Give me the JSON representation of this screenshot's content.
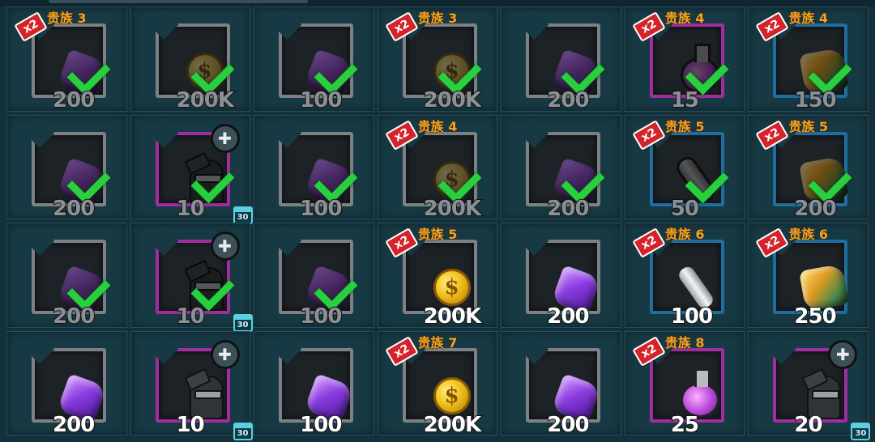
{
  "cells": [
    {
      "x2": "x2",
      "tier": "贵族 3",
      "item": "gem",
      "amount": "200",
      "claimed": true,
      "frame": "grey"
    },
    {
      "x2": "",
      "tier": "",
      "item": "coin",
      "amount": "200K",
      "claimed": true,
      "frame": "grey"
    },
    {
      "x2": "",
      "tier": "",
      "item": "gem",
      "amount": "100",
      "claimed": true,
      "frame": "grey"
    },
    {
      "x2": "x2",
      "tier": "贵族 3",
      "item": "coin",
      "amount": "200K",
      "claimed": true,
      "frame": "grey"
    },
    {
      "x2": "",
      "tier": "",
      "item": "gem",
      "amount": "200",
      "claimed": true,
      "frame": "grey"
    },
    {
      "x2": "x2",
      "tier": "贵族 4",
      "item": "flask",
      "amount": "15",
      "claimed": true,
      "frame": "purple"
    },
    {
      "x2": "x2",
      "tier": "贵族 4",
      "item": "stone",
      "amount": "150",
      "claimed": true,
      "frame": "blue"
    },
    {
      "x2": "",
      "tier": "",
      "item": "gem",
      "amount": "200",
      "claimed": true,
      "frame": "grey"
    },
    {
      "x2": "",
      "tier": "",
      "item": "hero",
      "amount": "10",
      "claimed": true,
      "frame": "purple",
      "puzzle": true,
      "calendar": "30"
    },
    {
      "x2": "",
      "tier": "",
      "item": "gem",
      "amount": "100",
      "claimed": true,
      "frame": "grey"
    },
    {
      "x2": "x2",
      "tier": "贵族 4",
      "item": "coin",
      "amount": "200K",
      "claimed": true,
      "frame": "grey"
    },
    {
      "x2": "",
      "tier": "",
      "item": "gem",
      "amount": "200",
      "claimed": true,
      "frame": "grey"
    },
    {
      "x2": "x2",
      "tier": "贵族 5",
      "item": "tube",
      "amount": "50",
      "claimed": true,
      "frame": "blue"
    },
    {
      "x2": "x2",
      "tier": "贵族 5",
      "item": "stone",
      "amount": "200",
      "claimed": true,
      "frame": "blue"
    },
    {
      "x2": "",
      "tier": "",
      "item": "gem",
      "amount": "200",
      "claimed": true,
      "frame": "grey"
    },
    {
      "x2": "",
      "tier": "",
      "item": "hero",
      "amount": "10",
      "claimed": true,
      "frame": "purple",
      "puzzle": true,
      "calendar": "30"
    },
    {
      "x2": "",
      "tier": "",
      "item": "gem",
      "amount": "100",
      "claimed": true,
      "frame": "grey"
    },
    {
      "x2": "x2",
      "tier": "贵族 5",
      "item": "coin",
      "amount": "200K",
      "claimed": false,
      "frame": "grey"
    },
    {
      "x2": "",
      "tier": "",
      "item": "gem",
      "amount": "200",
      "claimed": false,
      "frame": "grey"
    },
    {
      "x2": "x2",
      "tier": "贵族 6",
      "item": "tube",
      "amount": "100",
      "claimed": false,
      "frame": "blue"
    },
    {
      "x2": "x2",
      "tier": "贵族 6",
      "item": "stone",
      "amount": "250",
      "claimed": false,
      "frame": "blue"
    },
    {
      "x2": "",
      "tier": "",
      "item": "gem",
      "amount": "200",
      "claimed": false,
      "frame": "grey"
    },
    {
      "x2": "",
      "tier": "",
      "item": "hero",
      "amount": "10",
      "claimed": false,
      "frame": "purple",
      "puzzle": true,
      "calendar": "30"
    },
    {
      "x2": "",
      "tier": "",
      "item": "gem",
      "amount": "100",
      "claimed": false,
      "frame": "grey"
    },
    {
      "x2": "x2",
      "tier": "贵族 7",
      "item": "coin",
      "amount": "200K",
      "claimed": false,
      "frame": "grey"
    },
    {
      "x2": "",
      "tier": "",
      "item": "gem",
      "amount": "200",
      "claimed": false,
      "frame": "grey"
    },
    {
      "x2": "x2",
      "tier": "贵族 8",
      "item": "flask",
      "amount": "25",
      "claimed": false,
      "frame": "purple"
    },
    {
      "x2": "",
      "tier": "",
      "item": "hero",
      "amount": "20",
      "claimed": false,
      "frame": "purple",
      "puzzle": true,
      "calendar": "30"
    }
  ],
  "colors": {
    "background": "#14303a",
    "claimed_check": "#28d040",
    "tier_text": "#f2a528",
    "x2_badge": "#d4232a"
  },
  "icons": {
    "gem": "purple-gem-icon",
    "coin": "gold-coin-icon",
    "stone": "gold-ore-icon",
    "tube": "potion-vial-icon",
    "flask": "purple-potion-icon",
    "hero": "hero-shard-icon",
    "puzzle": "puzzle-piece-icon",
    "calendar": "calendar-icon"
  },
  "coin_symbol": "$",
  "puzzle_glyph": "✚"
}
